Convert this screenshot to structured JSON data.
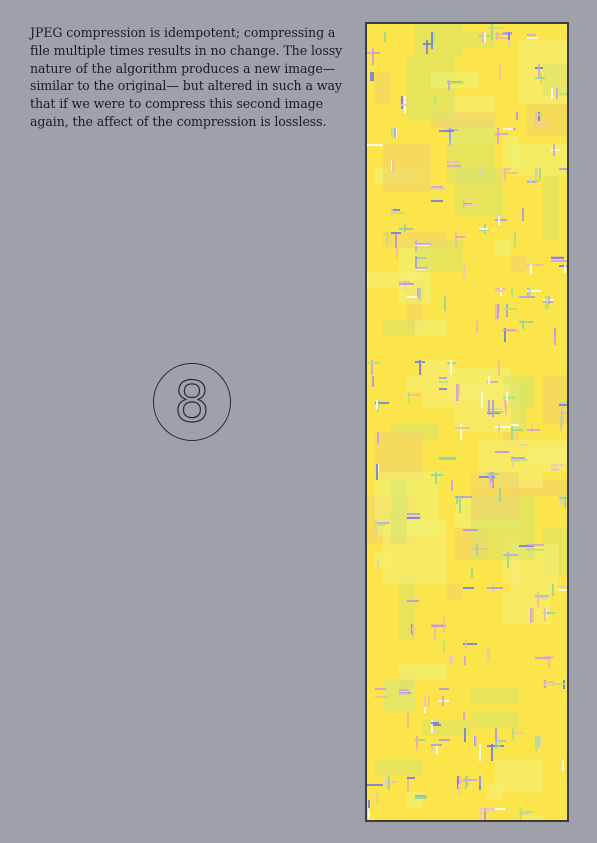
{
  "paragraph": "JPEG compression is idempotent; compressing a file multiple times results in no change. The lossy nature of the algorithm produces a new image—similar to the original— but altered in such a way that if we were to compress this second image again, the affect of the compression is lossless.",
  "page_number": "8",
  "colors": {
    "background": "#9ea1aa",
    "frame_border": "#3c3d42",
    "image_base": "#fbe54a",
    "artifact_palette": [
      "#f7ee7a",
      "#eef277",
      "#f0d26a",
      "#d7e46a",
      "#c9a0e6",
      "#b1e37a",
      "#f2b7a4",
      "#a99ae8",
      "#8ed6a0",
      "#e8c7c0",
      "#6f7be2",
      "#ffffff"
    ]
  },
  "image": {
    "description_icon": "jpeg-artifact-image"
  }
}
